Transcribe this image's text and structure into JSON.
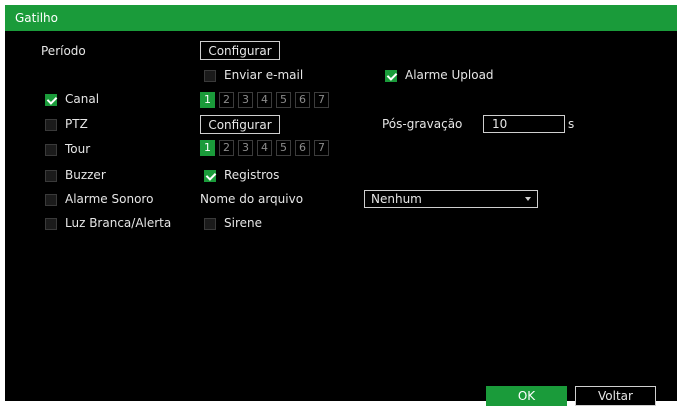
{
  "window": {
    "title": "Gatilho"
  },
  "periodo": {
    "label": "Período",
    "button": "Configurar"
  },
  "enviar_email": {
    "label": "Enviar e-mail",
    "checked": false
  },
  "alarme_upload": {
    "label": "Alarme Upload",
    "checked": true
  },
  "canal": {
    "label": "Canal",
    "checked": true,
    "channels": [
      "1",
      "2",
      "3",
      "4",
      "5",
      "6",
      "7"
    ],
    "selected": "1"
  },
  "ptz": {
    "label": "PTZ",
    "checked": false,
    "button": "Configurar"
  },
  "pos_gravacao": {
    "label": "Pós-gravação",
    "value": "10",
    "unit": "s"
  },
  "tour": {
    "label": "Tour",
    "checked": false,
    "channels": [
      "1",
      "2",
      "3",
      "4",
      "5",
      "6",
      "7"
    ],
    "selected": "1"
  },
  "buzzer": {
    "label": "Buzzer",
    "checked": false
  },
  "registros": {
    "label": "Registros",
    "checked": true
  },
  "alarme_sonoro": {
    "label": "Alarme Sonoro",
    "checked": false
  },
  "nome_arquivo": {
    "label": "Nome do arquivo",
    "value": "Nenhum"
  },
  "luz_branca": {
    "label": "Luz Branca/Alerta",
    "checked": false
  },
  "sirene": {
    "label": "Sirene",
    "checked": false
  },
  "footer": {
    "ok_label": "OK",
    "back_label": "Voltar"
  },
  "colors": {
    "accent": "#1a9b3a",
    "background": "#000000",
    "text": "#e6e6e6"
  }
}
